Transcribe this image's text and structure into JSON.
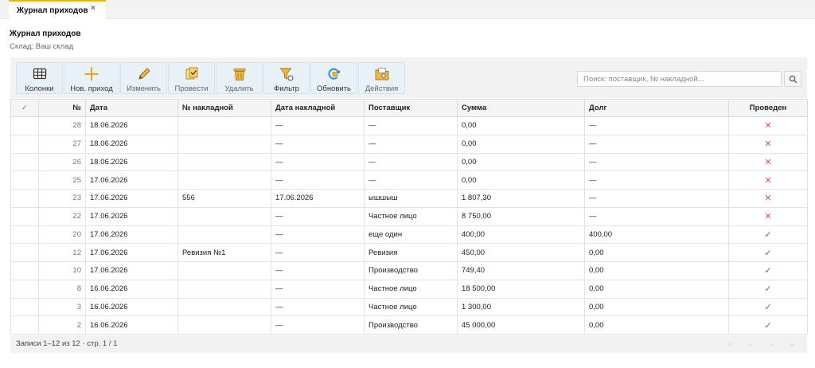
{
  "tabs": [
    {
      "label": "Журнал приходов",
      "close": "×"
    }
  ],
  "page": {
    "title": "Журнал приходов",
    "subtitle": "Склад: Ваш склад"
  },
  "toolbar": {
    "buttons": [
      {
        "label": "Колонки",
        "icon": "columns-grid-icon"
      },
      {
        "label": "Нов. приход",
        "icon": "plus-icon"
      },
      {
        "label": "Изменить",
        "icon": "pencil-icon"
      },
      {
        "label": "Провести",
        "icon": "post-document-icon"
      },
      {
        "label": "Удалить",
        "icon": "trash-icon"
      },
      {
        "label": "Фильтр",
        "icon": "filter-icon"
      },
      {
        "label": "Обновить",
        "icon": "refresh-icon"
      },
      {
        "label": "Действия",
        "icon": "folder-actions-icon"
      }
    ]
  },
  "search": {
    "placeholder": "Поиск: поставщик, № накладной...",
    "value": "",
    "icon": "search-icon"
  },
  "table": {
    "columns": [
      "✓",
      "№",
      "Дата",
      "№ накладной",
      "Дата накладной",
      "Поставщик",
      "Сумма",
      "Долг",
      "Проведен"
    ],
    "rows": [
      {
        "num": "28",
        "date": "18.06.2026",
        "invoice": "",
        "invoice_date": "—",
        "supplier": "—",
        "sum": "0,00",
        "debt": "—",
        "posted": "✕"
      },
      {
        "num": "27",
        "date": "18.06.2026",
        "invoice": "",
        "invoice_date": "—",
        "supplier": "—",
        "sum": "0,00",
        "debt": "—",
        "posted": "✕"
      },
      {
        "num": "26",
        "date": "18.06.2026",
        "invoice": "",
        "invoice_date": "—",
        "supplier": "—",
        "sum": "0,00",
        "debt": "—",
        "posted": "✕"
      },
      {
        "num": "25",
        "date": "17.06.2026",
        "invoice": "",
        "invoice_date": "—",
        "supplier": "—",
        "sum": "0,00",
        "debt": "—",
        "posted": "✕"
      },
      {
        "num": "23",
        "date": "17.06.2026",
        "invoice": "556",
        "invoice_date": "17.06.2026",
        "supplier": "ышшыш",
        "sum": "1 807,30",
        "debt": "—",
        "posted": "✕"
      },
      {
        "num": "22",
        "date": "17.06.2026",
        "invoice": "",
        "invoice_date": "—",
        "supplier": "Частное лицо",
        "sum": "8 750,00",
        "debt": "—",
        "posted": "✕"
      },
      {
        "num": "20",
        "date": "17.06.2026",
        "invoice": "",
        "invoice_date": "—",
        "supplier": "еще один",
        "sum": "400,00",
        "debt": "400,00",
        "posted": "✓"
      },
      {
        "num": "12",
        "date": "17.06.2026",
        "invoice": "Ревизия №1",
        "invoice_date": "—",
        "supplier": "Ревизия",
        "sum": "450,00",
        "debt": "0,00",
        "posted": "✓"
      },
      {
        "num": "10",
        "date": "17.06.2026",
        "invoice": "",
        "invoice_date": "—",
        "supplier": "Производство",
        "sum": "749,40",
        "debt": "0,00",
        "posted": "✓"
      },
      {
        "num": "8",
        "date": "16.06.2026",
        "invoice": "",
        "invoice_date": "—",
        "supplier": "Частное лицо",
        "sum": "18 500,00",
        "debt": "0,00",
        "posted": "✓"
      },
      {
        "num": "3",
        "date": "16.06.2026",
        "invoice": "",
        "invoice_date": "—",
        "supplier": "Частное лицо",
        "sum": "1 300,00",
        "debt": "0,00",
        "posted": "✓"
      },
      {
        "num": "2",
        "date": "16.06.2026",
        "invoice": "",
        "invoice_date": "—",
        "supplier": "Производство",
        "sum": "45 000,00",
        "debt": "0,00",
        "posted": "✓"
      }
    ]
  },
  "footer": {
    "text": "Записи 1–12 из 12 · стр. 1 / 1",
    "pager": [
      "«",
      "‹",
      "›",
      "»"
    ]
  },
  "colors": {
    "accent": "#f2b600",
    "button_bg": "#e7f1f7",
    "posted_no": "#d9534f",
    "posted_yes": "#2e9a46"
  }
}
